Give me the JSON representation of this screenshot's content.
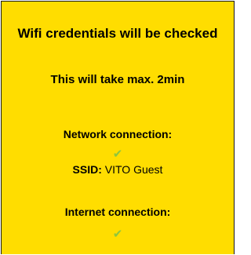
{
  "dialog": {
    "title": "Wifi credentials will be checked",
    "duration_note": "This will take max. 2min",
    "network": {
      "heading": "Network connection:",
      "status_icon": "checkmark-icon",
      "ssid_label": "SSID:",
      "ssid_value": "VITO Guest"
    },
    "internet": {
      "heading": "Internet connection:",
      "status_icon": "checkmark-icon"
    }
  },
  "colors": {
    "background": "#ffdd00",
    "check": "#8cc63f",
    "text": "#000000"
  }
}
